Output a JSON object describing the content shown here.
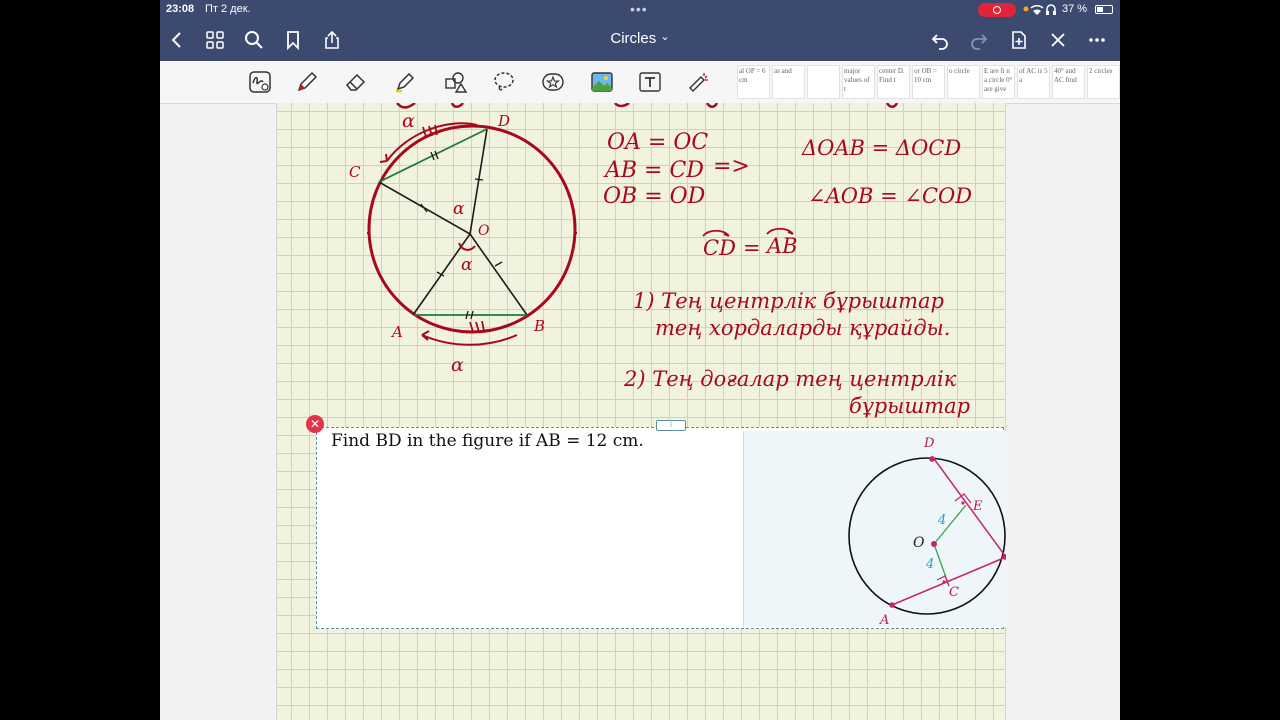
{
  "status_bar": {
    "time": "23:08",
    "date": "Пт 2 дек.",
    "battery": "37 %"
  },
  "nav": {
    "title": "Circles",
    "title_chevron": "⌄"
  },
  "thumbnails": [
    {
      "text": "al OP = 6 cm"
    },
    {
      "text": "as and"
    },
    {
      "text": ""
    },
    {
      "text": "major values of t"
    },
    {
      "text": "center D. Find t"
    },
    {
      "text": "or OB = 10 cm"
    },
    {
      "text": "o circle"
    },
    {
      "text": "E are fi n a circle 0° are give"
    },
    {
      "text": "of AC is 5 a"
    },
    {
      "text": "40° and AC find"
    },
    {
      "text": "2 circles"
    },
    {
      "text": ""
    }
  ],
  "notes": {
    "eq1": "OA = OC",
    "eq2": "AB = CD",
    "eq3": "OB = OD",
    "implies": "=>",
    "tri": "ΔOAB = ΔOCD",
    "ang": "∠AOB = ∠COD",
    "arc_cd": "CD",
    "arc_eq": "=",
    "arc_ab": "AB",
    "rule1_line1": "1) Тең центрлік бұрыштар",
    "rule1_line2": "тең хордаларды құрайды.",
    "rule2_line1": "2) Тең доғалар тең центрлік",
    "rule2_line2": "бұрыштар"
  },
  "sketch": {
    "label_d": "D",
    "label_c": "C",
    "label_o": "O",
    "label_a": "A",
    "label_b": "B",
    "alpha_top": "α",
    "alpha_center_up": "α",
    "alpha_center_down": "α",
    "alpha_bottom": "α"
  },
  "problem": {
    "text": "Find BD in the figure if AB = 12 cm.",
    "close_symbol": "✕",
    "handle_symbol": "⁝"
  },
  "figure": {
    "label_d": "D",
    "label_e": "E",
    "label_o": "O",
    "label_c": "C",
    "label_a": "A",
    "dist_1": "4",
    "dist_2": "4"
  },
  "colors": {
    "nav_bg": "#3d4a70",
    "ink_red": "#a8081b",
    "ink_green": "#1f7a38",
    "figure_magenta": "#c4266a",
    "figure_teal": "#2aa3b9"
  }
}
